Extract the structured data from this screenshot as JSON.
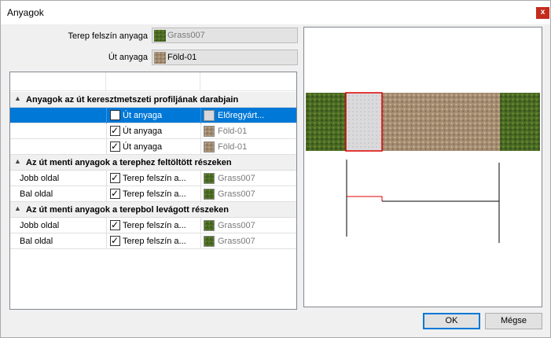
{
  "window": {
    "title": "Anyagok",
    "close_label": "x"
  },
  "fields": [
    {
      "label": "Terep felszín anyaga",
      "value": "Grass007",
      "value_style": "grey",
      "swatch": "grass"
    },
    {
      "label": "Út anyaga",
      "value": "Föld-01",
      "value_style": "normal",
      "swatch": "dirt"
    }
  ],
  "grid": {
    "groups": [
      {
        "title": "Anyagok az út keresztmetszeti profiljának darabjain",
        "rows": [
          {
            "name": "",
            "checked": false,
            "material": "Út anyaga",
            "value": "Előregyárt...",
            "swatch": "concrete",
            "selected": true
          },
          {
            "name": "",
            "checked": true,
            "material": "Út anyaga",
            "value": "Föld-01",
            "swatch": "dirt",
            "selected": false
          },
          {
            "name": "",
            "checked": true,
            "material": "Út anyaga",
            "value": "Föld-01",
            "swatch": "dirt",
            "selected": false
          }
        ]
      },
      {
        "title": "Az út menti anyagok a terephez feltöltött részeken",
        "rows": [
          {
            "name": "Jobb oldal",
            "checked": true,
            "material": "Terep felszín a...",
            "value": "Grass007",
            "swatch": "grass",
            "selected": false
          },
          {
            "name": "Bal oldal",
            "checked": true,
            "material": "Terep felszín a...",
            "value": "Grass007",
            "swatch": "grass",
            "selected": false
          }
        ]
      },
      {
        "title": "Az út menti anyagok a terepbol levágott részeken",
        "rows": [
          {
            "name": "Jobb oldal",
            "checked": true,
            "material": "Terep felszín a...",
            "value": "Grass007",
            "swatch": "grass",
            "selected": false
          },
          {
            "name": "Bal oldal",
            "checked": true,
            "material": "Terep felszín a...",
            "value": "Grass007",
            "swatch": "grass",
            "selected": false
          }
        ]
      }
    ]
  },
  "buttons": {
    "ok": "OK",
    "cancel": "Mégse"
  },
  "colors": {
    "accent": "#0078d7",
    "close": "#c42b1c",
    "highlight": "#e00000"
  }
}
